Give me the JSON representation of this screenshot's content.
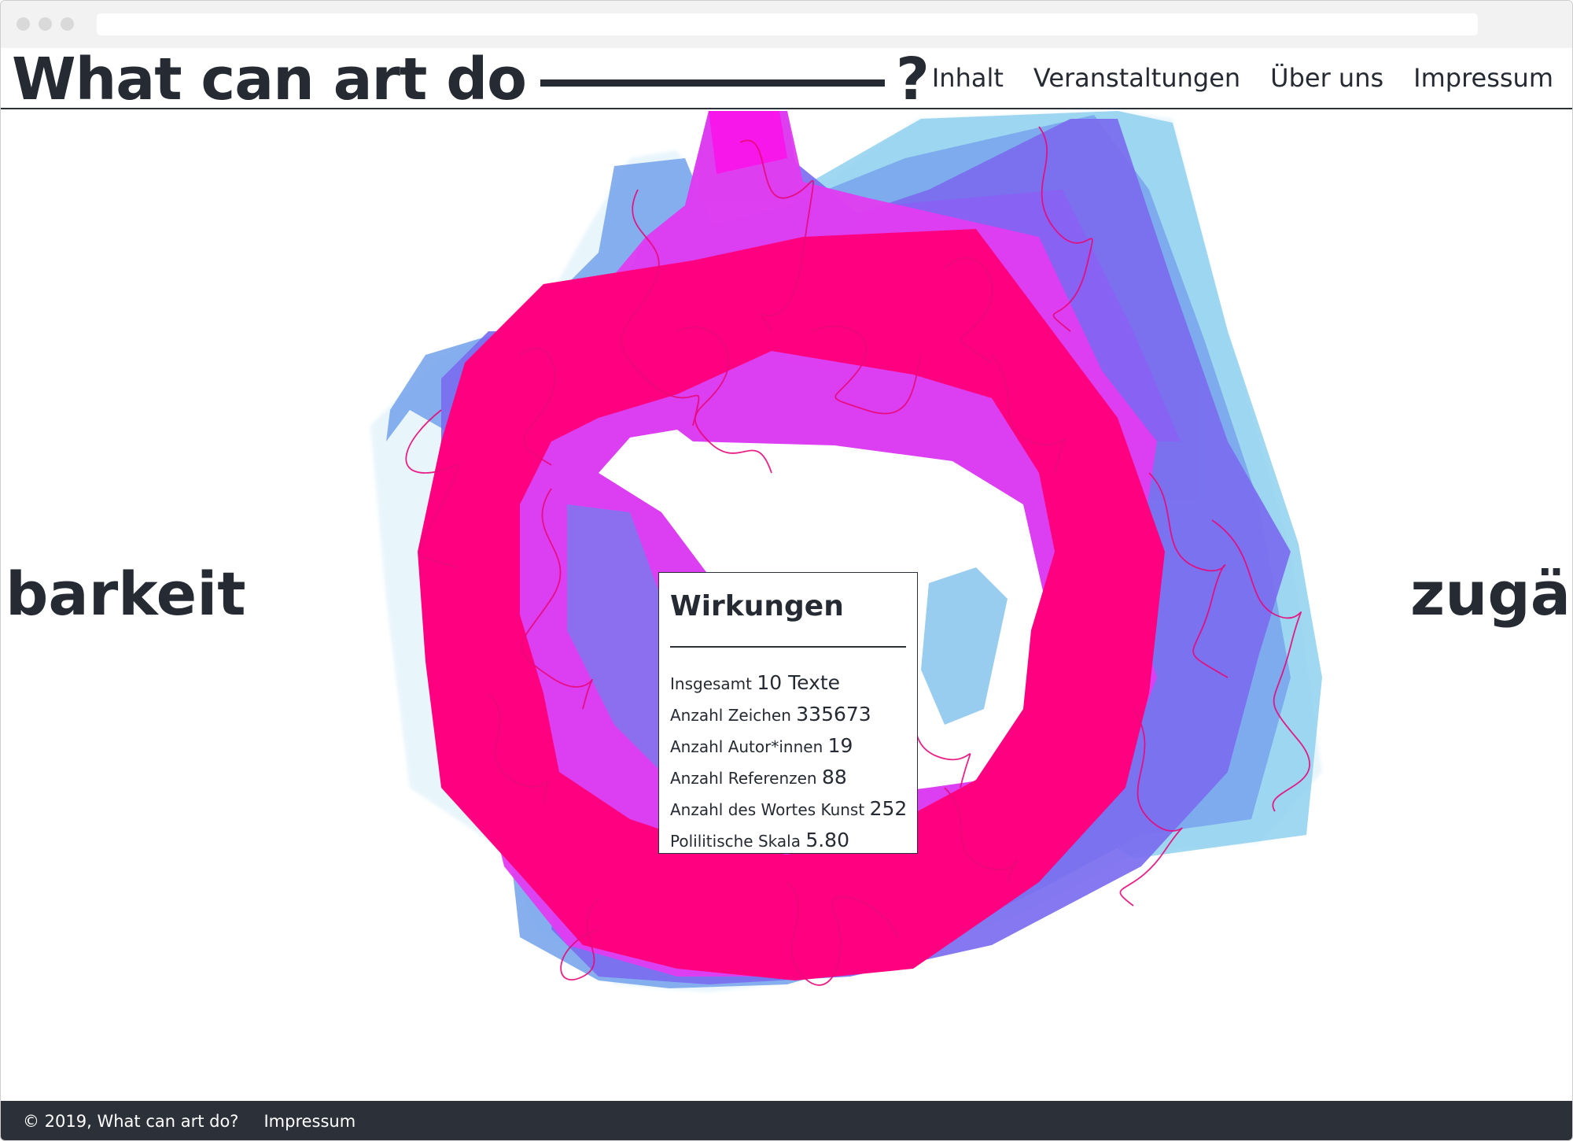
{
  "header": {
    "title_prefix": "What can art do",
    "title_suffix": "?",
    "nav": [
      {
        "label": "Inhalt"
      },
      {
        "label": "Veranstaltungen"
      },
      {
        "label": "Über uns"
      },
      {
        "label": "Impressum"
      }
    ]
  },
  "stage": {
    "left_word": "barkeit",
    "right_word": "zugän"
  },
  "card": {
    "title": "Wirkungen",
    "stats": [
      {
        "label": "Insgesamt",
        "value": "10 Texte"
      },
      {
        "label": "Anzahl Zeichen",
        "value": "335673"
      },
      {
        "label": "Anzahl Autor*innen",
        "value": "19"
      },
      {
        "label": "Anzahl Referenzen",
        "value": "88"
      },
      {
        "label": "Anzahl des Wortes Kunst",
        "value": "252"
      },
      {
        "label": "Polilitische Skala",
        "value": "5.80"
      }
    ]
  },
  "footer": {
    "copyright": "© 2019, What can art do?",
    "link": "Impressum"
  },
  "colors": {
    "ink": "#262b33",
    "ring": "#ff0080",
    "magenta": "#ff00ee",
    "violet": "#a84cff",
    "blue": "#6f78f0",
    "sky": "#8ecdee"
  }
}
